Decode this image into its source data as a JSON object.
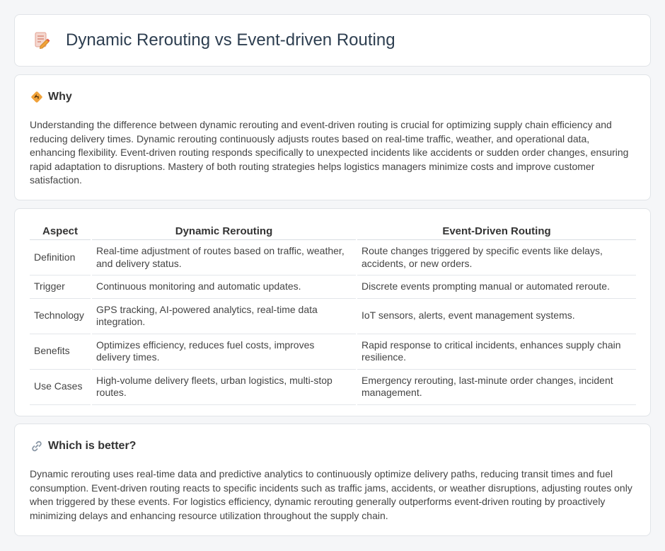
{
  "header": {
    "title": "Dynamic Rerouting vs Event-driven Routing",
    "icon": "document-pencil-icon"
  },
  "why": {
    "icon": "signpost-icon",
    "title": "Why",
    "text": "Understanding the difference between dynamic rerouting and event-driven routing is crucial for optimizing supply chain efficiency and reducing delivery times. Dynamic rerouting continuously adjusts routes based on real-time traffic, weather, and operational data, enhancing flexibility. Event-driven routing responds specifically to unexpected incidents like accidents or sudden order changes, ensuring rapid adaptation to disruptions. Mastery of both routing strategies helps logistics managers minimize costs and improve customer satisfaction."
  },
  "comparison": {
    "headers": [
      "Aspect",
      "Dynamic Rerouting",
      "Event-Driven Routing"
    ],
    "rows": [
      [
        "Definition",
        "Real-time adjustment of routes based on traffic, weather, and delivery status.",
        "Route changes triggered by specific events like delays, accidents, or new orders."
      ],
      [
        "Trigger",
        "Continuous monitoring and automatic updates.",
        "Discrete events prompting manual or automated reroute."
      ],
      [
        "Technology",
        "GPS tracking, AI-powered analytics, real-time data integration.",
        "IoT sensors, alerts, event management systems."
      ],
      [
        "Benefits",
        "Optimizes efficiency, reduces fuel costs, improves delivery times.",
        "Rapid response to critical incidents, enhances supply chain resilience."
      ],
      [
        "Use Cases",
        "High-volume delivery fleets, urban logistics, multi-stop routes.",
        "Emergency rerouting, last-minute order changes, incident management."
      ]
    ]
  },
  "better": {
    "icon": "link-icon",
    "title": "Which is better?",
    "text": "Dynamic rerouting uses real-time data and predictive analytics to continuously optimize delivery paths, reducing transit times and fuel consumption. Event-driven routing reacts to specific incidents such as traffic jams, accidents, or weather disruptions, adjusting routes only when triggered by these events. For logistics efficiency, dynamic rerouting generally outperforms event-driven routing by proactively minimizing delays and enhancing resource utilization throughout the supply chain."
  },
  "colors": {
    "background": "#f5f6f8",
    "title_text": "#2d3e50",
    "icon_accent": "#f0a23a"
  }
}
